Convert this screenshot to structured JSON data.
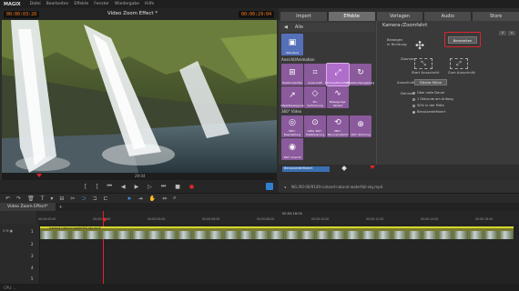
{
  "menubar": {
    "logo": "MAGIX",
    "items": [
      "Datei",
      "Bearbeiten",
      "Effekte",
      "Fenster",
      "Wiedergabe",
      "Hilfe"
    ]
  },
  "player": {
    "timecode_left": "00:00:03:28",
    "title": "Video Zoom Effect *",
    "timecode_right": "00:00:29:04",
    "scrub_label": "29:04"
  },
  "transport": {
    "buttons": [
      "[",
      "]",
      "⏮",
      "◀",
      "▶",
      "▷",
      "⏭",
      "■",
      "●"
    ]
  },
  "right_tabs": [
    {
      "label": "Import",
      "active": false
    },
    {
      "label": "Effekte",
      "active": true
    },
    {
      "label": "Vorlagen",
      "active": false
    },
    {
      "label": "Audio",
      "active": false
    },
    {
      "label": "Store",
      "active": false
    }
  ],
  "effects": {
    "category_back": "◀",
    "category_label": "Alle",
    "standard_tile": "Standard",
    "section1": "Ansicht/Animation",
    "row1": [
      "Position/Größe",
      "Ausschnitt",
      "Kamera/Zoomfahrt",
      "Rotation/Spiegelung"
    ],
    "row2": [
      "Objektbewegung",
      "3D-Verformung",
      "Bewegungs-Verlauf"
    ],
    "section2": "360° Video",
    "row3": [
      "360°-Bearbeitung",
      "Little 360°-Stabilisierung",
      "360°-Panoramafahrt",
      "360°-Stitching"
    ],
    "row4": [
      "360°-Ansicht"
    ]
  },
  "properties": {
    "title": "Kamera-/Zoomfahrt",
    "keyframe_label": "Bewegen in Richtung",
    "edit_button": "Bearbeiten",
    "zoom_label": "Zoomen",
    "zoom_in": "Start Ausschnitt",
    "zoom_out": "Zum Ausschnitt",
    "crop_label": "Ausschnitt",
    "crop_button": "Fläche füllen",
    "duration_label": "Dehnen",
    "options": [
      {
        "label": "Über volle Dauer",
        "checked": false
      },
      {
        "label": "1 Sekunde am Anfang",
        "checked": false
      },
      {
        "label": "50% in der Mitte",
        "checked": false
      },
      {
        "label": "Benutzerdefiniert",
        "checked": true
      }
    ]
  },
  "bottom_strip": {
    "item": "Benutzerdefiniert"
  },
  "pathbar": {
    "path": "NG:/00-00/9149-iceland-natural-waterfall-sky.mp4"
  },
  "timeline": {
    "tab": "Video Zoom Effect*",
    "tracks": [
      "1",
      "2",
      "3",
      "4",
      "5"
    ],
    "ruler_marks": [
      "00:00:00:00",
      "00:00:02:00",
      "00:00:04:00",
      "00:00:06:00",
      "00:00:08:00",
      "00:00:10:00",
      "00:00:12:00",
      "00:00:14:00",
      "00:00:16:00"
    ],
    "ruler_top": "00:00:16:00",
    "clip_label": "iceland-natural-waterfall-sky.mp4"
  },
  "status": {
    "text": "CPU: ..."
  },
  "colors": {
    "accent_orange": "#ff7a1a",
    "effect_tile": "#8a5a9c",
    "highlight_red": "#e0242a",
    "clip_yellow": "#d6d62e"
  }
}
